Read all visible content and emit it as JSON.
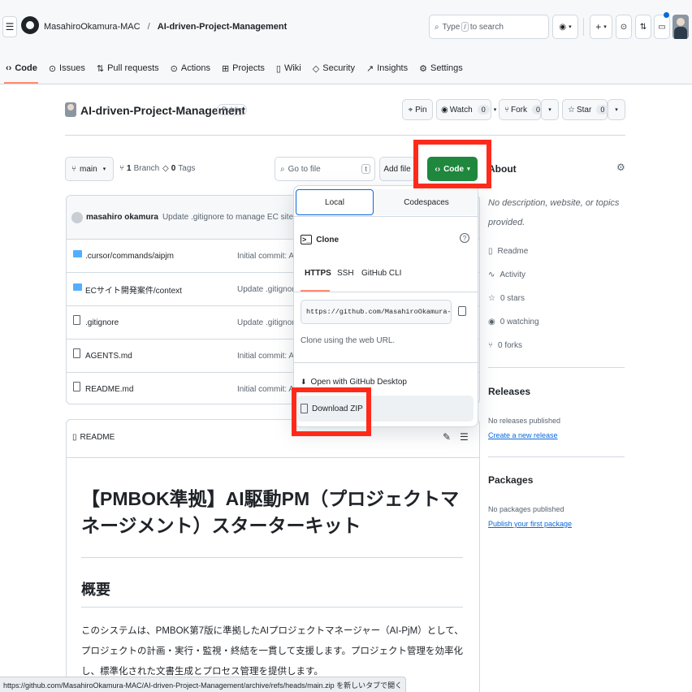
{
  "header": {
    "owner": "MasahiroOkamura-MAC",
    "slash": "/",
    "repo": "AI-driven-Project-Management",
    "search_placeholder_prefix": "Type",
    "search_key": "/",
    "search_placeholder_suffix": "to search",
    "plus_label": "+"
  },
  "nav": {
    "tabs": [
      {
        "label": "Code",
        "icon": "code-icon"
      },
      {
        "label": "Issues",
        "icon": "issue-icon"
      },
      {
        "label": "Pull requests",
        "icon": "pull-request-icon"
      },
      {
        "label": "Actions",
        "icon": "actions-icon"
      },
      {
        "label": "Projects",
        "icon": "projects-icon"
      },
      {
        "label": "Wiki",
        "icon": "book-icon"
      },
      {
        "label": "Security",
        "icon": "shield-icon"
      },
      {
        "label": "Insights",
        "icon": "graph-icon"
      },
      {
        "label": "Settings",
        "icon": "gear-icon"
      }
    ]
  },
  "repo": {
    "name": "AI-driven-Project-Management",
    "visibility": "Public",
    "pin": "Pin",
    "watch": "Watch",
    "watch_count": "0",
    "fork": "Fork",
    "fork_count": "0",
    "star": "Star",
    "star_count": "0"
  },
  "toolbar": {
    "branch": "main",
    "branches_count": "1",
    "branches_label": "Branch",
    "tags_count": "0",
    "tags_label": "Tags",
    "goto_placeholder": "Go to file",
    "goto_key": "t",
    "add_file": "Add file",
    "code_button": "Code"
  },
  "commit": {
    "author": "masahiro okamura",
    "message": "Update .gitignore to manage EC site project folder"
  },
  "files": [
    {
      "name": ".cursor/commands/aipjm",
      "type": "folder",
      "message": "Initial commit: AI-d"
    },
    {
      "name": "ECサイト開発案件/context",
      "type": "folder",
      "message": "Update .gitignore t"
    },
    {
      "name": ".gitignore",
      "type": "file",
      "message": "Update .gitignore t"
    },
    {
      "name": "AGENTS.md",
      "type": "file",
      "message": "Initial commit: AI-d"
    },
    {
      "name": "README.md",
      "type": "file",
      "message": "Initial commit: AI-d"
    }
  ],
  "readme": {
    "tab": "README",
    "title": "【PMBOK準拠】AI駆動PM（プロジェクトマネージメント）スターターキット",
    "h2": "概要",
    "body": "このシステムは、PMBOK第7版に準拠したAIプロジェクトマネージャー（AI-PjM）として、プロジェクトの計画・実行・監視・終結を一貫して支援します。プロジェクト管理を効率化し、標準化された文書生成とプロセス管理を提供します。"
  },
  "dropdown": {
    "tab_local": "Local",
    "tab_codespaces": "Codespaces",
    "clone_label": "Clone",
    "proto_https": "HTTPS",
    "proto_ssh": "SSH",
    "proto_cli": "GitHub CLI",
    "clone_url": "https://github.com/MasahiroOkamura-MAC/AI-driven-Project-Management.git",
    "clone_hint": "Clone using the web URL.",
    "open_desktop": "Open with GitHub Desktop",
    "download_zip": "Download ZIP"
  },
  "sidebar": {
    "about_heading": "About",
    "description": "No description, website, or topics provided.",
    "items": [
      {
        "label": "Readme",
        "icon": "book-icon"
      },
      {
        "label": "Activity",
        "icon": "pulse-icon"
      },
      {
        "label": "0 stars",
        "icon": "star-icon"
      },
      {
        "label": "0 watching",
        "icon": "eye-icon"
      },
      {
        "label": "0 forks",
        "icon": "fork-icon"
      }
    ],
    "releases_heading": "Releases",
    "releases_text": "No releases published",
    "releases_link": "Create a new release",
    "packages_heading": "Packages",
    "packages_text": "No packages published",
    "packages_link": "Publish your first package"
  },
  "status_bar": {
    "text": "https://github.com/MasahiroOkamura-MAC/AI-driven-Project-Management/archive/refs/heads/main.zip を新しいタブで開く"
  },
  "colors": {
    "accent_green": "#1f883d",
    "link_blue": "#0969da",
    "highlight_red": "#ff2a1a",
    "tab_underline": "#fd8c73"
  }
}
